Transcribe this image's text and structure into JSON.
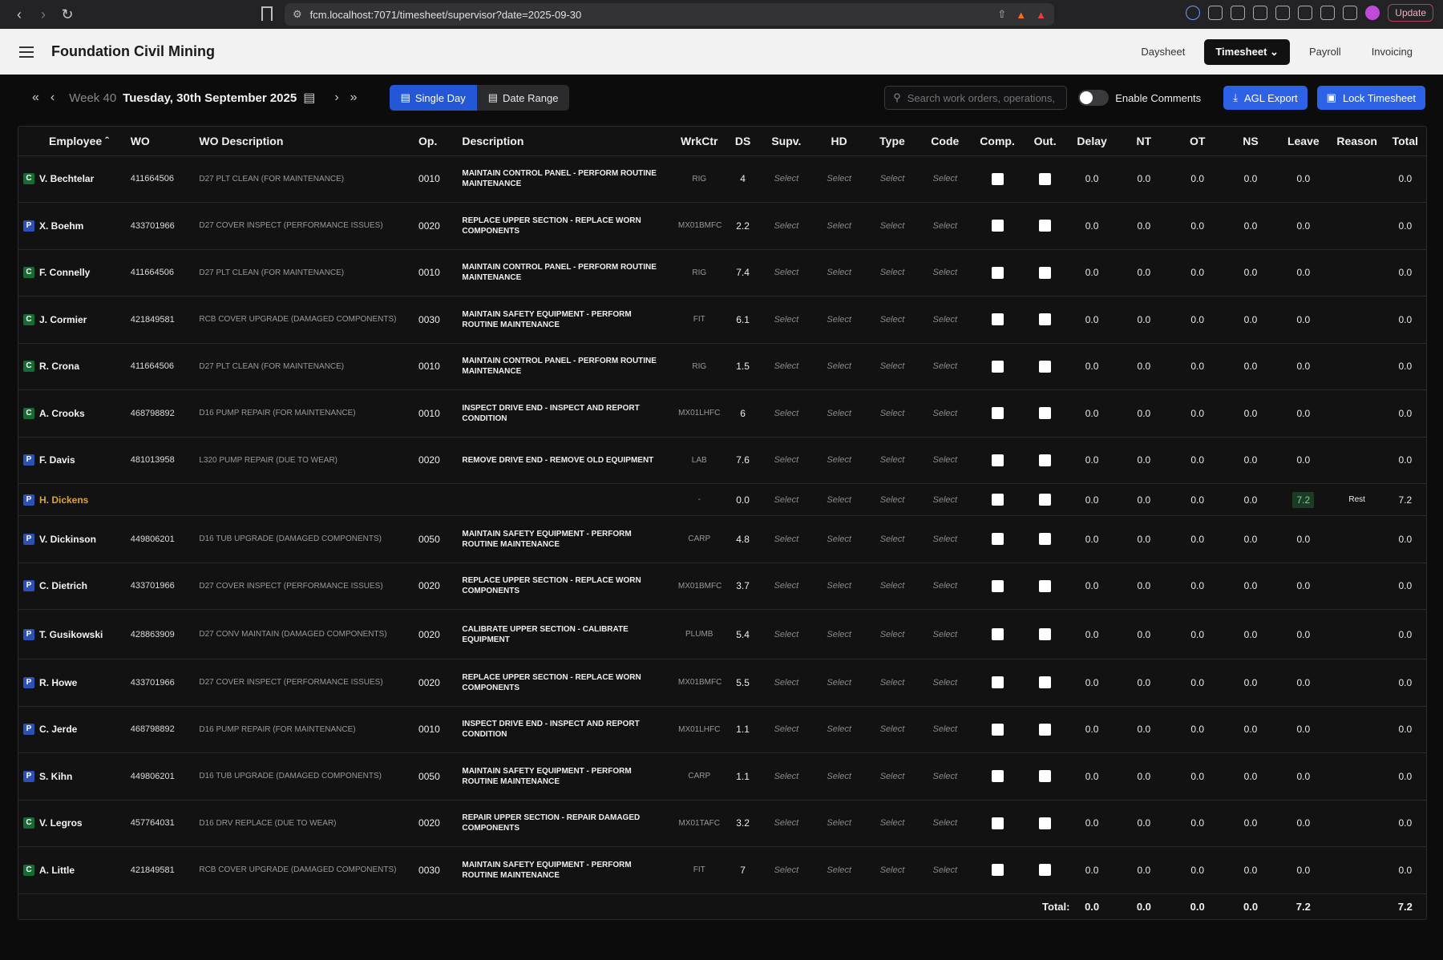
{
  "browser": {
    "url": "fcm.localhost:7071/timesheet/supervisor?date=2025-09-30",
    "update_label": "Update"
  },
  "app": {
    "title": "Foundation Civil Mining",
    "nav": [
      {
        "label": "Daysheet"
      },
      {
        "label": "Timesheet"
      },
      {
        "label": "Payroll"
      },
      {
        "label": "Invoicing"
      }
    ]
  },
  "toolbar": {
    "week": "Week 40",
    "date": "Tuesday, 30th September 2025",
    "single_day": "Single Day",
    "date_range": "Date Range",
    "search_placeholder": "Search work orders, operations,",
    "enable_comments": "Enable Comments",
    "agl_export": "AGL Export",
    "lock_timesheet": "Lock Timesheet"
  },
  "table": {
    "headers": [
      "Employee",
      "WO",
      "WO Description",
      "Op.",
      "Description",
      "WrkCtr",
      "DS",
      "Supv.",
      "HD",
      "Type",
      "Code",
      "Comp.",
      "Out.",
      "Delay",
      "NT",
      "OT",
      "NS",
      "Leave",
      "Reason",
      "Total"
    ],
    "select_label": "Select",
    "rows": [
      {
        "badge": "C",
        "name": "V. Bechtelar",
        "wo": "411664506",
        "wodesc": "D27 PLT CLEAN (FOR MAINTENANCE)",
        "op": "0010",
        "desc": "MAINTAIN CONTROL PANEL - PERFORM ROUTINE MAINTENANCE",
        "wrk": "RIG",
        "ds": "4",
        "delay": "0.0",
        "nt": "0.0",
        "ot": "0.0",
        "ns": "0.0",
        "leave": "0.0",
        "reason": "",
        "total": "0.0"
      },
      {
        "badge": "P",
        "name": "X. Boehm",
        "wo": "433701966",
        "wodesc": "D27 COVER INSPECT (PERFORMANCE ISSUES)",
        "op": "0020",
        "desc": "REPLACE UPPER SECTION - REPLACE WORN COMPONENTS",
        "wrk": "MX01BMFC",
        "ds": "2.2",
        "delay": "0.0",
        "nt": "0.0",
        "ot": "0.0",
        "ns": "0.0",
        "leave": "0.0",
        "reason": "",
        "total": "0.0"
      },
      {
        "badge": "C",
        "name": "F. Connelly",
        "wo": "411664506",
        "wodesc": "D27 PLT CLEAN (FOR MAINTENANCE)",
        "op": "0010",
        "desc": "MAINTAIN CONTROL PANEL - PERFORM ROUTINE MAINTENANCE",
        "wrk": "RIG",
        "ds": "7.4",
        "delay": "0.0",
        "nt": "0.0",
        "ot": "0.0",
        "ns": "0.0",
        "leave": "0.0",
        "reason": "",
        "total": "0.0"
      },
      {
        "badge": "C",
        "name": "J. Cormier",
        "wo": "421849581",
        "wodesc": "RCB COVER UPGRADE (DAMAGED COMPONENTS)",
        "op": "0030",
        "desc": "MAINTAIN SAFETY EQUIPMENT - PERFORM ROUTINE MAINTENANCE",
        "wrk": "FIT",
        "ds": "6.1",
        "delay": "0.0",
        "nt": "0.0",
        "ot": "0.0",
        "ns": "0.0",
        "leave": "0.0",
        "reason": "",
        "total": "0.0"
      },
      {
        "badge": "C",
        "name": "R. Crona",
        "wo": "411664506",
        "wodesc": "D27 PLT CLEAN (FOR MAINTENANCE)",
        "op": "0010",
        "desc": "MAINTAIN CONTROL PANEL - PERFORM ROUTINE MAINTENANCE",
        "wrk": "RIG",
        "ds": "1.5",
        "delay": "0.0",
        "nt": "0.0",
        "ot": "0.0",
        "ns": "0.0",
        "leave": "0.0",
        "reason": "",
        "total": "0.0"
      },
      {
        "badge": "C",
        "name": "A. Crooks",
        "wo": "468798892",
        "wodesc": "D16 PUMP REPAIR (FOR MAINTENANCE)",
        "op": "0010",
        "desc": "INSPECT DRIVE END - INSPECT AND REPORT CONDITION",
        "wrk": "MX01LHFC",
        "ds": "6",
        "delay": "0.0",
        "nt": "0.0",
        "ot": "0.0",
        "ns": "0.0",
        "leave": "0.0",
        "reason": "",
        "total": "0.0"
      },
      {
        "badge": "P",
        "name": "F. Davis",
        "wo": "481013958",
        "wodesc": "L320 PUMP REPAIR (DUE TO WEAR)",
        "op": "0020",
        "desc": "REMOVE DRIVE END - REMOVE OLD EQUIPMENT",
        "wrk": "LAB",
        "ds": "7.6",
        "delay": "0.0",
        "nt": "0.0",
        "ot": "0.0",
        "ns": "0.0",
        "leave": "0.0",
        "reason": "",
        "total": "0.0"
      },
      {
        "badge": "P",
        "name": "H. Dickens",
        "highlight": true,
        "wo": "",
        "wodesc": "",
        "op": "",
        "desc": "",
        "wrk": "-",
        "ds": "0.0",
        "delay": "0.0",
        "nt": "0.0",
        "ot": "0.0",
        "ns": "0.0",
        "leave": "7.2",
        "leave_highlight": true,
        "reason": "Rest",
        "total": "7.2"
      },
      {
        "badge": "P",
        "name": "V. Dickinson",
        "wo": "449806201",
        "wodesc": "D16 TUB UPGRADE (DAMAGED COMPONENTS)",
        "op": "0050",
        "desc": "MAINTAIN SAFETY EQUIPMENT - PERFORM ROUTINE MAINTENANCE",
        "wrk": "CARP",
        "ds": "4.8",
        "delay": "0.0",
        "nt": "0.0",
        "ot": "0.0",
        "ns": "0.0",
        "leave": "0.0",
        "reason": "",
        "total": "0.0"
      },
      {
        "badge": "P",
        "name": "C. Dietrich",
        "wo": "433701966",
        "wodesc": "D27 COVER INSPECT (PERFORMANCE ISSUES)",
        "op": "0020",
        "desc": "REPLACE UPPER SECTION - REPLACE WORN COMPONENTS",
        "wrk": "MX01BMFC",
        "ds": "3.7",
        "delay": "0.0",
        "nt": "0.0",
        "ot": "0.0",
        "ns": "0.0",
        "leave": "0.0",
        "reason": "",
        "total": "0.0"
      },
      {
        "badge": "P",
        "name": "T. Gusikowski",
        "wo": "428863909",
        "wodesc": "D27 CONV MAINTAIN (DAMAGED COMPONENTS)",
        "op": "0020",
        "desc": "CALIBRATE UPPER SECTION - CALIBRATE EQUIPMENT",
        "wrk": "PLUMB",
        "ds": "5.4",
        "delay": "0.0",
        "nt": "0.0",
        "ot": "0.0",
        "ns": "0.0",
        "leave": "0.0",
        "reason": "",
        "total": "0.0"
      },
      {
        "badge": "P",
        "name": "R. Howe",
        "wo": "433701966",
        "wodesc": "D27 COVER INSPECT (PERFORMANCE ISSUES)",
        "op": "0020",
        "desc": "REPLACE UPPER SECTION - REPLACE WORN COMPONENTS",
        "wrk": "MX01BMFC",
        "ds": "5.5",
        "delay": "0.0",
        "nt": "0.0",
        "ot": "0.0",
        "ns": "0.0",
        "leave": "0.0",
        "reason": "",
        "total": "0.0"
      },
      {
        "badge": "P",
        "name": "C. Jerde",
        "wo": "468798892",
        "wodesc": "D16 PUMP REPAIR (FOR MAINTENANCE)",
        "op": "0010",
        "desc": "INSPECT DRIVE END - INSPECT AND REPORT CONDITION",
        "wrk": "MX01LHFC",
        "ds": "1.1",
        "delay": "0.0",
        "nt": "0.0",
        "ot": "0.0",
        "ns": "0.0",
        "leave": "0.0",
        "reason": "",
        "total": "0.0"
      },
      {
        "badge": "P",
        "name": "S. Kihn",
        "wo": "449806201",
        "wodesc": "D16 TUB UPGRADE (DAMAGED COMPONENTS)",
        "op": "0050",
        "desc": "MAINTAIN SAFETY EQUIPMENT - PERFORM ROUTINE MAINTENANCE",
        "wrk": "CARP",
        "ds": "1.1",
        "delay": "0.0",
        "nt": "0.0",
        "ot": "0.0",
        "ns": "0.0",
        "leave": "0.0",
        "reason": "",
        "total": "0.0"
      },
      {
        "badge": "C",
        "name": "V. Legros",
        "wo": "457764031",
        "wodesc": "D16 DRV REPLACE (DUE TO WEAR)",
        "op": "0020",
        "desc": "REPAIR UPPER SECTION - REPAIR DAMAGED COMPONENTS",
        "wrk": "MX01TAFC",
        "ds": "3.2",
        "delay": "0.0",
        "nt": "0.0",
        "ot": "0.0",
        "ns": "0.0",
        "leave": "0.0",
        "reason": "",
        "total": "0.0"
      },
      {
        "badge": "C",
        "name": "A. Little",
        "wo": "421849581",
        "wodesc": "RCB COVER UPGRADE (DAMAGED COMPONENTS)",
        "op": "0030",
        "desc": "MAINTAIN SAFETY EQUIPMENT - PERFORM ROUTINE MAINTENANCE",
        "wrk": "FIT",
        "ds": "7",
        "delay": "0.0",
        "nt": "0.0",
        "ot": "0.0",
        "ns": "0.0",
        "leave": "0.0",
        "reason": "",
        "total": "0.0"
      }
    ],
    "totals": {
      "label": "Total:",
      "delay": "0.0",
      "nt": "0.0",
      "ot": "0.0",
      "ns": "0.0",
      "leave": "7.2",
      "total": "7.2"
    }
  }
}
